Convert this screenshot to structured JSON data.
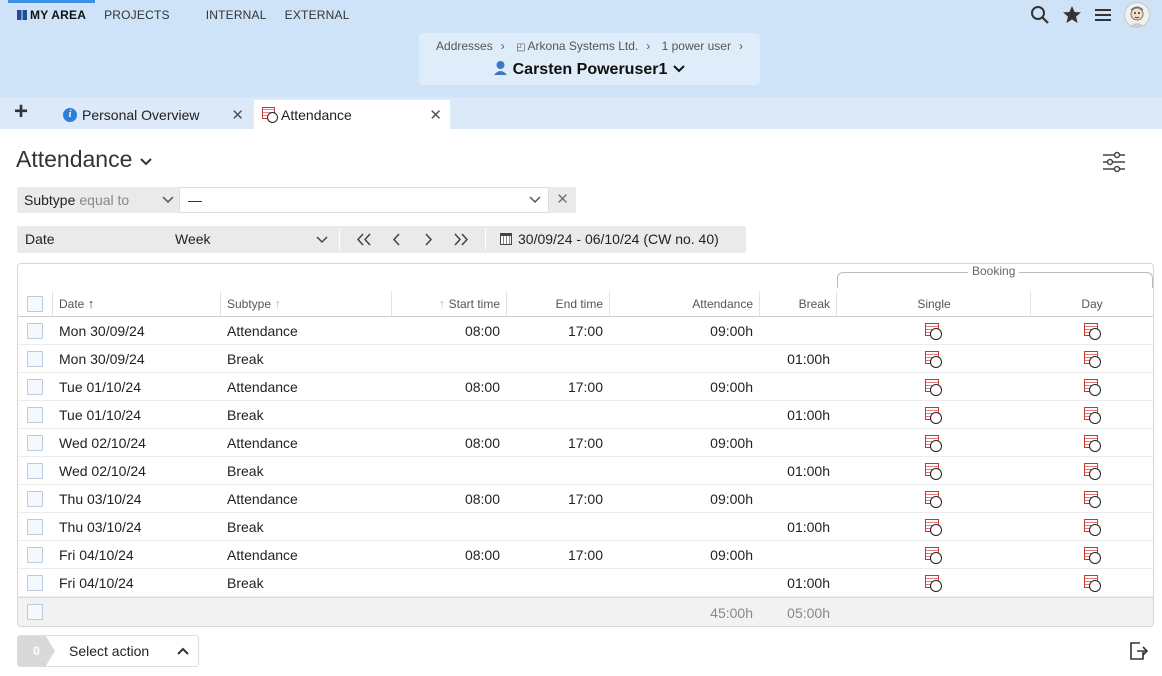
{
  "nav": {
    "items": [
      {
        "label": "MY AREA",
        "active": true
      },
      {
        "label": "PROJECTS",
        "active": false
      },
      {
        "label": "INTERNAL",
        "active": false
      },
      {
        "label": "EXTERNAL",
        "active": false
      }
    ],
    "icons": [
      "search-icon",
      "star-icon",
      "menu-icon",
      "avatar"
    ]
  },
  "breadcrumb": {
    "items": [
      "Addresses",
      "Arkona Systems Ltd.",
      "1 power user"
    ],
    "person": "Carsten Poweruser1"
  },
  "tabs": {
    "add": "+",
    "items": [
      {
        "label": "Personal Overview",
        "icon": "info-icon"
      },
      {
        "label": "Attendance",
        "icon": "attendance-icon"
      }
    ]
  },
  "page": {
    "title": "Attendance"
  },
  "filter": {
    "field": "Subtype",
    "operator": "equal to",
    "value": "—"
  },
  "daterange": {
    "label": "Date",
    "period": "Week",
    "range": "30/09/24 - 06/10/24 (CW no. 40)"
  },
  "table": {
    "group_label": "Booking",
    "columns": {
      "date": "Date",
      "subtype": "Subtype",
      "start": "Start time",
      "end": "End time",
      "attendance": "Attendance",
      "break": "Break",
      "single": "Single",
      "day": "Day"
    },
    "rows": [
      {
        "date": "Mon 30/09/24",
        "subtype": "Attendance",
        "start": "08:00",
        "end": "17:00",
        "attendance": "09:00h",
        "break": ""
      },
      {
        "date": "Mon 30/09/24",
        "subtype": "Break",
        "start": "",
        "end": "",
        "attendance": "",
        "break": "01:00h"
      },
      {
        "date": "Tue 01/10/24",
        "subtype": "Attendance",
        "start": "08:00",
        "end": "17:00",
        "attendance": "09:00h",
        "break": ""
      },
      {
        "date": "Tue 01/10/24",
        "subtype": "Break",
        "start": "",
        "end": "",
        "attendance": "",
        "break": "01:00h"
      },
      {
        "date": "Wed 02/10/24",
        "subtype": "Attendance",
        "start": "08:00",
        "end": "17:00",
        "attendance": "09:00h",
        "break": ""
      },
      {
        "date": "Wed 02/10/24",
        "subtype": "Break",
        "start": "",
        "end": "",
        "attendance": "",
        "break": "01:00h"
      },
      {
        "date": "Thu 03/10/24",
        "subtype": "Attendance",
        "start": "08:00",
        "end": "17:00",
        "attendance": "09:00h",
        "break": ""
      },
      {
        "date": "Thu 03/10/24",
        "subtype": "Break",
        "start": "",
        "end": "",
        "attendance": "",
        "break": "01:00h"
      },
      {
        "date": "Fri 04/10/24",
        "subtype": "Attendance",
        "start": "08:00",
        "end": "17:00",
        "attendance": "09:00h",
        "break": ""
      },
      {
        "date": "Fri 04/10/24",
        "subtype": "Break",
        "start": "",
        "end": "",
        "attendance": "",
        "break": "01:00h"
      }
    ],
    "totals": {
      "attendance": "45:00h",
      "break": "05:00h"
    }
  },
  "footer": {
    "selected_count": "0",
    "action_label": "Select action"
  }
}
